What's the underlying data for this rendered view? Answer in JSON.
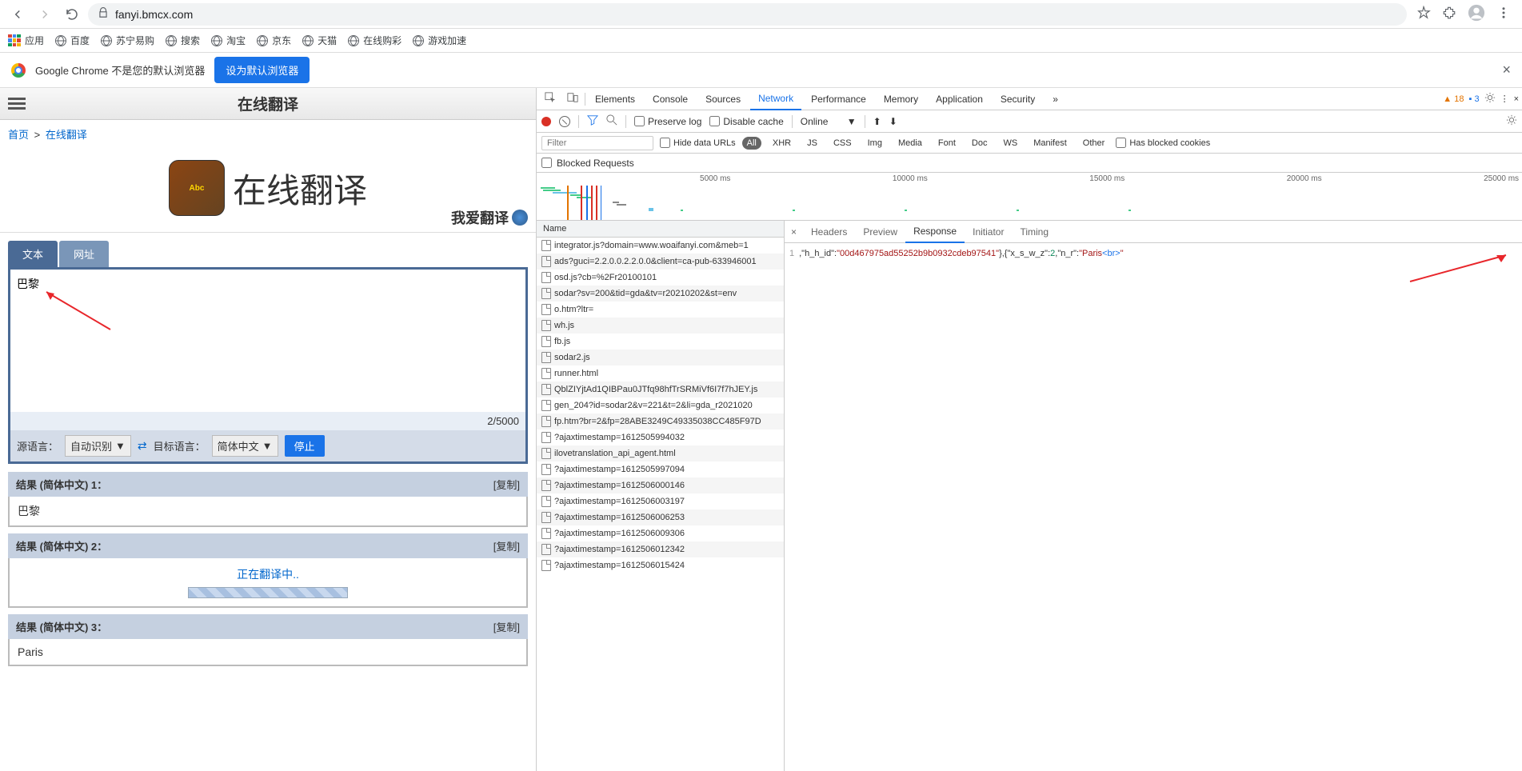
{
  "browser": {
    "url": "fanyi.bmcx.com",
    "bookmarks": [
      {
        "label": "应用",
        "icon": "apps"
      },
      {
        "label": "百度",
        "icon": "globe"
      },
      {
        "label": "苏宁易购",
        "icon": "globe"
      },
      {
        "label": "搜索",
        "icon": "globe"
      },
      {
        "label": "淘宝",
        "icon": "globe"
      },
      {
        "label": "京东",
        "icon": "globe"
      },
      {
        "label": "天猫",
        "icon": "globe"
      },
      {
        "label": "在线购彩",
        "icon": "globe"
      },
      {
        "label": "游戏加速",
        "icon": "globe"
      }
    ]
  },
  "banner": {
    "text": "Google Chrome 不是您的默认浏览器",
    "button": "设为默认浏览器"
  },
  "site": {
    "header_title": "在线翻译",
    "breadcrumb_home": "首页",
    "breadcrumb_sep": ">",
    "breadcrumb_current": "在线翻译",
    "big_title": "在线翻译",
    "love_translate": "我爱翻译"
  },
  "tabs": {
    "text": "文本",
    "url": "网址"
  },
  "input": {
    "value": "巴黎",
    "count": "2/5000"
  },
  "lang": {
    "source_label": "源语言：",
    "source_value": "自动识别",
    "target_label": "目标语言：",
    "target_value": "简体中文",
    "stop": "停止"
  },
  "results": [
    {
      "title": "结果 (简体中文) 1：",
      "copy": "[复制]",
      "body": "巴黎",
      "kind": "text"
    },
    {
      "title": "结果 (简体中文) 2：",
      "copy": "[复制]",
      "body": "正在翻译中..",
      "kind": "loading"
    },
    {
      "title": "结果 (简体中文) 3：",
      "copy": "[复制]",
      "body": "Paris",
      "kind": "text"
    }
  ],
  "devtools": {
    "tabs": [
      "Elements",
      "Console",
      "Sources",
      "Network",
      "Performance",
      "Memory",
      "Application",
      "Security"
    ],
    "active_tab": "Network",
    "warnings": "18",
    "infos": "3",
    "preserve_log": "Preserve log",
    "disable_cache": "Disable cache",
    "online": "Online",
    "filter_placeholder": "Filter",
    "hide_data_urls": "Hide data URLs",
    "types": [
      "All",
      "XHR",
      "JS",
      "CSS",
      "Img",
      "Media",
      "Font",
      "Doc",
      "WS",
      "Manifest",
      "Other"
    ],
    "has_blocked": "Has blocked cookies",
    "blocked_requests": "Blocked Requests",
    "time_labels": [
      "5000 ms",
      "10000 ms",
      "15000 ms",
      "20000 ms",
      "25000 ms"
    ],
    "name_header": "Name",
    "requests": [
      "integrator.js?domain=www.woaifanyi.com&meb=1",
      "ads?guci=2.2.0.0.2.2.0.0&client=ca-pub-633946001",
      "osd.js?cb=%2Fr20100101",
      "sodar?sv=200&tid=gda&tv=r20210202&st=env",
      "o.htm?ltr=",
      "wh.js",
      "fb.js",
      "sodar2.js",
      "runner.html",
      "QblZIYjtAd1QIBPau0JTfq98hfTrSRMiVf6I7f7hJEY.js",
      "gen_204?id=sodar2&v=221&t=2&li=gda_r2021020",
      "fp.htm?br=2&fp=28ABE3249C49335038CC485F97D",
      "?ajaxtimestamp=1612505994032",
      "ilovetranslation_api_agent.html",
      "?ajaxtimestamp=1612505997094",
      "?ajaxtimestamp=1612506000146",
      "?ajaxtimestamp=1612506003197",
      "?ajaxtimestamp=1612506006253",
      "?ajaxtimestamp=1612506009306",
      "?ajaxtimestamp=1612506012342",
      "?ajaxtimestamp=1612506015424"
    ],
    "detail_tabs": [
      "Headers",
      "Preview",
      "Response",
      "Initiator",
      "Timing"
    ],
    "detail_active": "Response",
    "response_line_prefix": "1",
    "response_h_h_id_key": ",\"h_h_id\":",
    "response_h_h_id_val": "\"00d467975ad55252b9b0932cdeb97541\"",
    "response_close1": "},{",
    "response_x_key": "\"x_s_w_z\":",
    "response_x_val": "2",
    "response_nr_key": ",\"n_r\":",
    "response_nr_val_open": "\"Paris",
    "response_br": "<br>",
    "response_nr_val_close": "\""
  }
}
